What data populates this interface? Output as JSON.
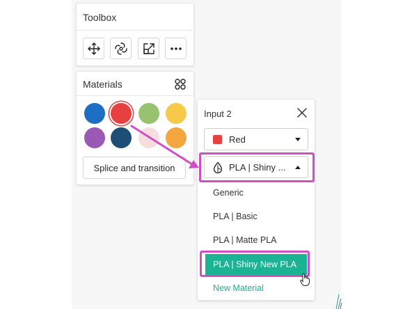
{
  "toolbox": {
    "title": "Toolbox",
    "tools": [
      {
        "name": "move-icon"
      },
      {
        "name": "rotate-icon"
      },
      {
        "name": "scale-icon"
      },
      {
        "name": "more-icon"
      }
    ]
  },
  "materials": {
    "title": "Materials",
    "grid_icon": "grid-icon",
    "swatches": [
      {
        "color": "#1e6fc4"
      },
      {
        "color": "#e84040",
        "selected": true
      },
      {
        "color": "#98c26f"
      },
      {
        "color": "#f7c948"
      },
      {
        "color": "#9b59b6"
      },
      {
        "color": "#1d4e75"
      },
      {
        "color": "#f7dede"
      },
      {
        "color": "#f3a640"
      }
    ],
    "splice_button": "Splice and transition"
  },
  "input_panel": {
    "title": "Input 2",
    "color_select": {
      "value": "Red",
      "chip_color": "#e94040"
    },
    "material_select": {
      "value": "PLA | Shiny ..."
    },
    "menu": [
      {
        "label": "Generic"
      },
      {
        "label": "PLA | Basic"
      },
      {
        "label": "PLA | Matte PLA"
      },
      {
        "label": "PLA | Shiny New PLA",
        "active": true
      },
      {
        "label": "New Material",
        "new": true
      }
    ]
  },
  "colors": {
    "accent": "#1bb394",
    "highlight": "#d04fc6",
    "arrow": "#d04fc6"
  }
}
